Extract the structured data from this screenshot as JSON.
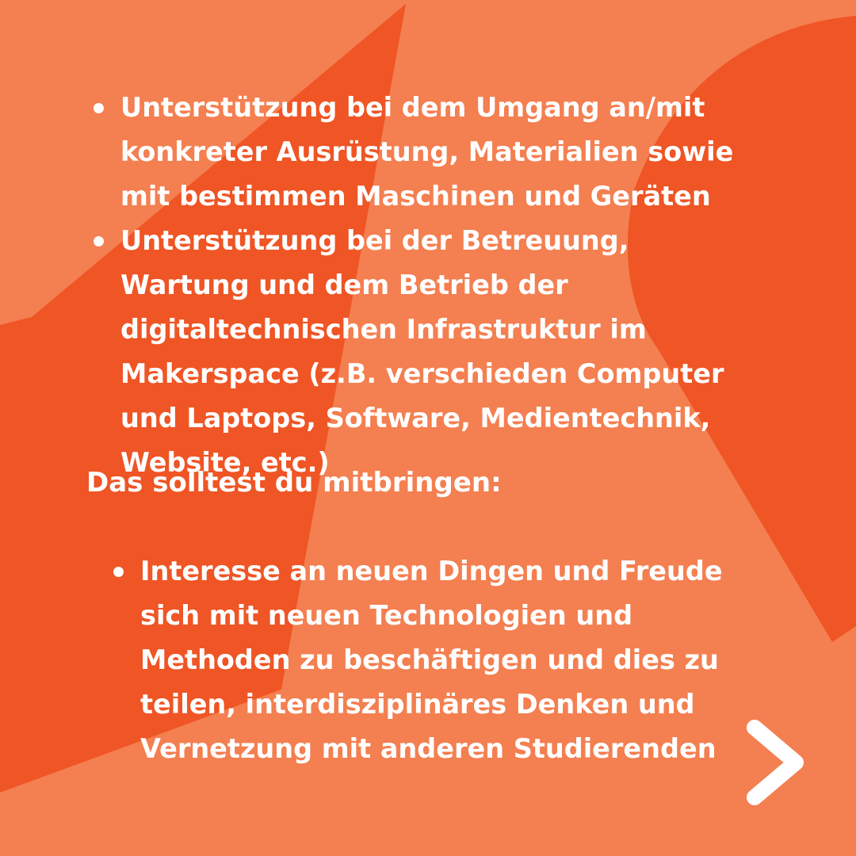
{
  "colors": {
    "background_light": "#F47F50",
    "shape_dark": "#EF5525",
    "text": "#FFFFFF"
  },
  "tasks": {
    "items": [
      "Unterstützung bei dem Umgang an/mit konkreter Ausrüstung, Materialien sowie mit bestimmen Maschinen und Geräten",
      "Unterstützung bei der Betreuung, Wartung und dem Betrieb der digitaltechnischen Infrastruktur im Makerspace (z.B. verschieden Computer und Laptops, Software, Medientechnik, Website, etc.)"
    ]
  },
  "requirements": {
    "heading": "Das solltest du mitbringen:",
    "items": [
      "Interesse an neuen Dingen und Freude sich mit neuen Technologien und Methoden zu beschäftigen und dies zu teilen, interdisziplinäres Denken und Vernetzung mit anderen Studierenden"
    ]
  },
  "navigation": {
    "next_icon": "chevron-right-icon"
  }
}
